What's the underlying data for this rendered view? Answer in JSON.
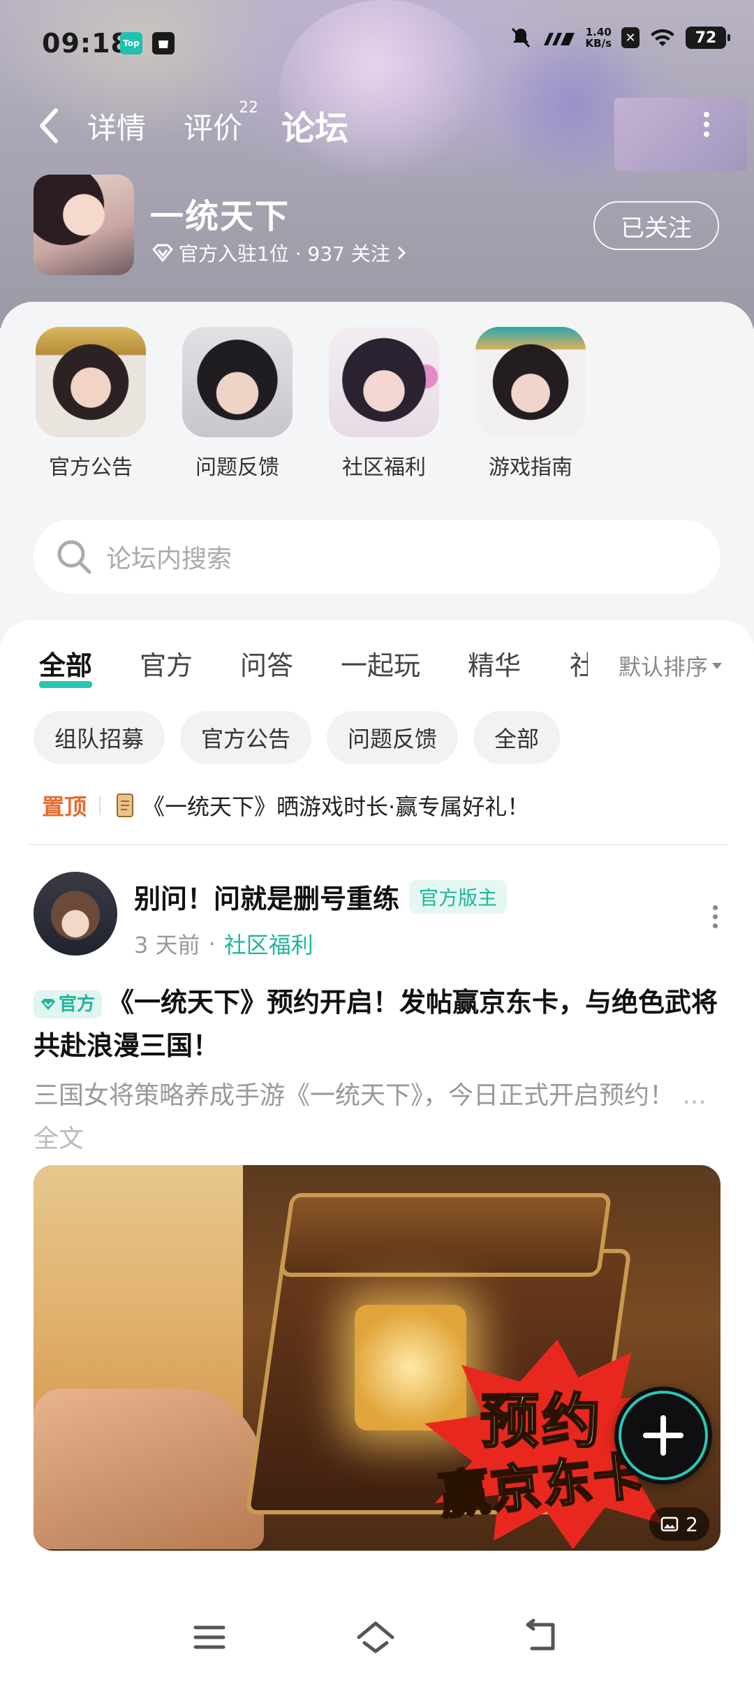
{
  "status_bar": {
    "time": "09:18",
    "network_speed": "1.40",
    "network_unit": "KB/s",
    "battery": "72",
    "top_badge": "Top"
  },
  "nav": {
    "tabs": [
      "详情",
      "评价",
      "论坛"
    ],
    "review_count": "22",
    "active_tab": "论坛"
  },
  "game": {
    "name": "一统天下",
    "meta": "官方入驻1位 · 937 关注",
    "follow_label": "已关注"
  },
  "categories": [
    {
      "label": "官方公告"
    },
    {
      "label": "问题反馈"
    },
    {
      "label": "社区福利"
    },
    {
      "label": "游戏指南"
    }
  ],
  "search": {
    "placeholder": "论坛内搜索"
  },
  "feed_tabs": [
    "全部",
    "官方",
    "问答",
    "一起玩",
    "精华",
    "社"
  ],
  "sort_label": "默认排序",
  "chips": [
    "组队招募",
    "官方公告",
    "问题反馈",
    "全部"
  ],
  "pinned": {
    "tag": "置顶",
    "title": "《一统天下》晒游戏时长·赢专属好礼！"
  },
  "post": {
    "author": "别问！问就是删号重练",
    "author_badge": "官方版主",
    "time": "3 天前",
    "dot": "·",
    "board": "社区福利",
    "official_tag": "官方",
    "title": "《一统天下》预约开启！发帖赢京东卡，与绝色武将共赴浪漫三国！",
    "body": "三国女将策略养成手游《一统天下》，今日正式开启预约！",
    "ellipsis": "...",
    "full_text": "全文",
    "image_text_1": "预约",
    "image_text_2": "赢京东卡",
    "image_count": "2"
  },
  "colors": {
    "accent": "#28c7b0",
    "pinned": "#e96a2d"
  }
}
